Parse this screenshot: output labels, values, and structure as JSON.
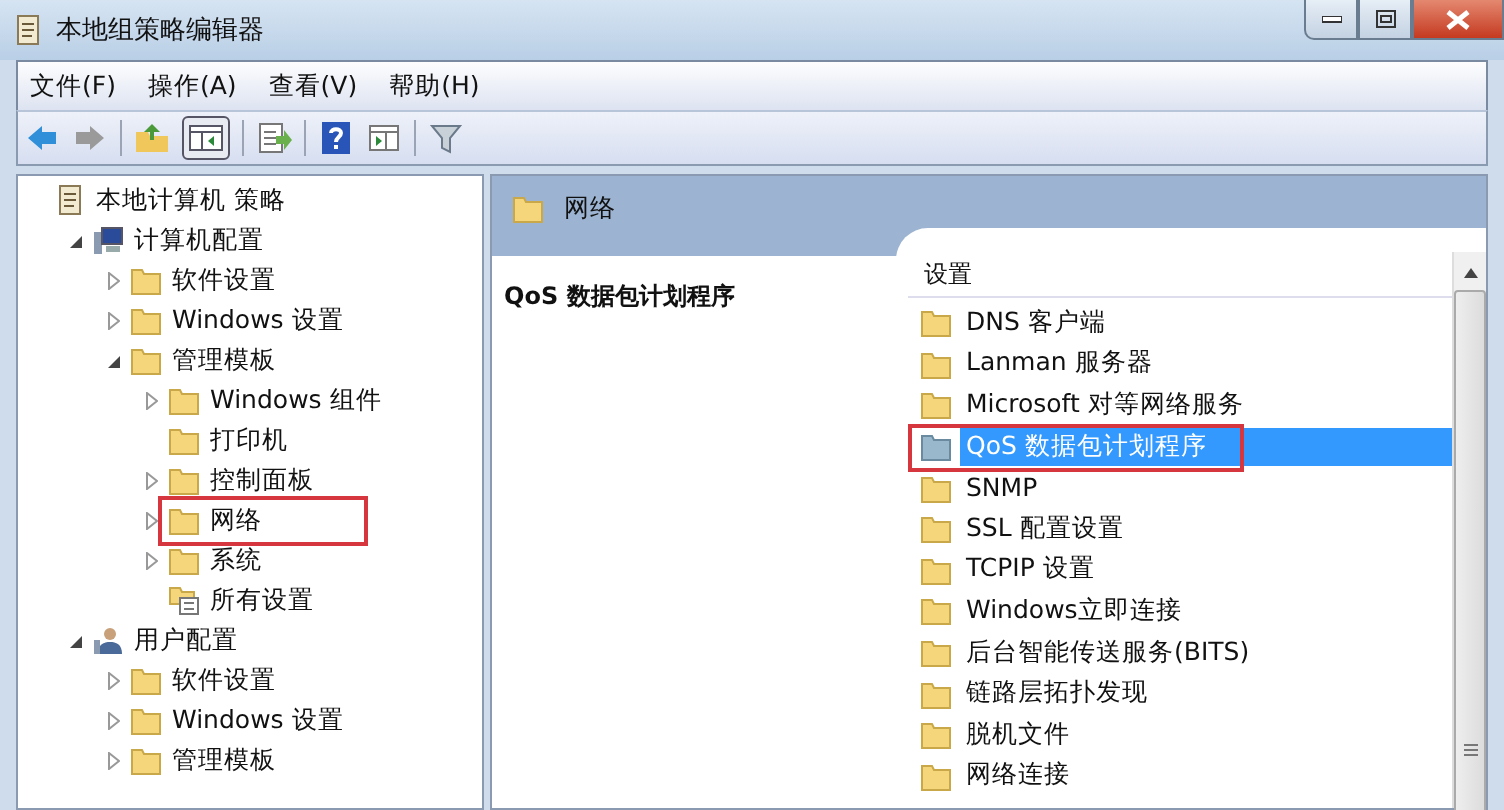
{
  "window": {
    "title": "本地组策略编辑器"
  },
  "menu": [
    "文件(F)",
    "操作(A)",
    "查看(V)",
    "帮助(H)"
  ],
  "tree": [
    {
      "label": "本地计算机 策略",
      "kind": "policy",
      "highlighted": false,
      "children": [
        {
          "label": "计算机配置",
          "kind": "computer",
          "expanded": true,
          "highlighted": false,
          "children": [
            {
              "label": "软件设置",
              "kind": "folder",
              "expanded": false,
              "highlighted": false
            },
            {
              "label": "Windows 设置",
              "kind": "folder",
              "expanded": false,
              "highlighted": false
            },
            {
              "label": "管理模板",
              "kind": "folder",
              "expanded": true,
              "highlighted": false,
              "children": [
                {
                  "label": "Windows 组件",
                  "kind": "folder",
                  "expanded": false,
                  "highlighted": false
                },
                {
                  "label": "打印机",
                  "kind": "folder",
                  "highlighted": false
                },
                {
                  "label": "控制面板",
                  "kind": "folder",
                  "expanded": false,
                  "highlighted": false
                },
                {
                  "label": "网络",
                  "kind": "folder",
                  "expanded": false,
                  "highlighted": true
                },
                {
                  "label": "系统",
                  "kind": "folder",
                  "expanded": false,
                  "highlighted": false
                },
                {
                  "label": "所有设置",
                  "kind": "settings",
                  "highlighted": false
                }
              ]
            }
          ]
        },
        {
          "label": "用户配置",
          "kind": "user",
          "expanded": true,
          "highlighted": false,
          "children": [
            {
              "label": "软件设置",
              "kind": "folder",
              "expanded": false,
              "highlighted": false
            },
            {
              "label": "Windows 设置",
              "kind": "folder",
              "expanded": false,
              "highlighted": false
            },
            {
              "label": "管理模板",
              "kind": "folder",
              "expanded": false,
              "highlighted": false
            }
          ]
        }
      ]
    }
  ],
  "header": {
    "title": "网络"
  },
  "description": {
    "title": "QoS 数据包计划程序"
  },
  "list": {
    "column": "设置",
    "rows": [
      {
        "label": "DNS 客户端",
        "selected": false,
        "highlighted": false
      },
      {
        "label": "Lanman 服务器",
        "selected": false,
        "highlighted": false
      },
      {
        "label": "Microsoft 对等网络服务",
        "selected": false,
        "highlighted": false
      },
      {
        "label": "QoS 数据包计划程序",
        "selected": true,
        "highlighted": true
      },
      {
        "label": "SNMP",
        "selected": false,
        "highlighted": false
      },
      {
        "label": "SSL 配置设置",
        "selected": false,
        "highlighted": false
      },
      {
        "label": "TCPIP 设置",
        "selected": false,
        "highlighted": false
      },
      {
        "label": "Windows立即连接",
        "selected": false,
        "highlighted": false
      },
      {
        "label": "后台智能传送服务(BITS)",
        "selected": false,
        "highlighted": false
      },
      {
        "label": "链路层拓扑发现",
        "selected": false,
        "highlighted": false
      },
      {
        "label": "脱机文件",
        "selected": false,
        "highlighted": false
      },
      {
        "label": "网络连接",
        "selected": false,
        "highlighted": false
      }
    ]
  }
}
